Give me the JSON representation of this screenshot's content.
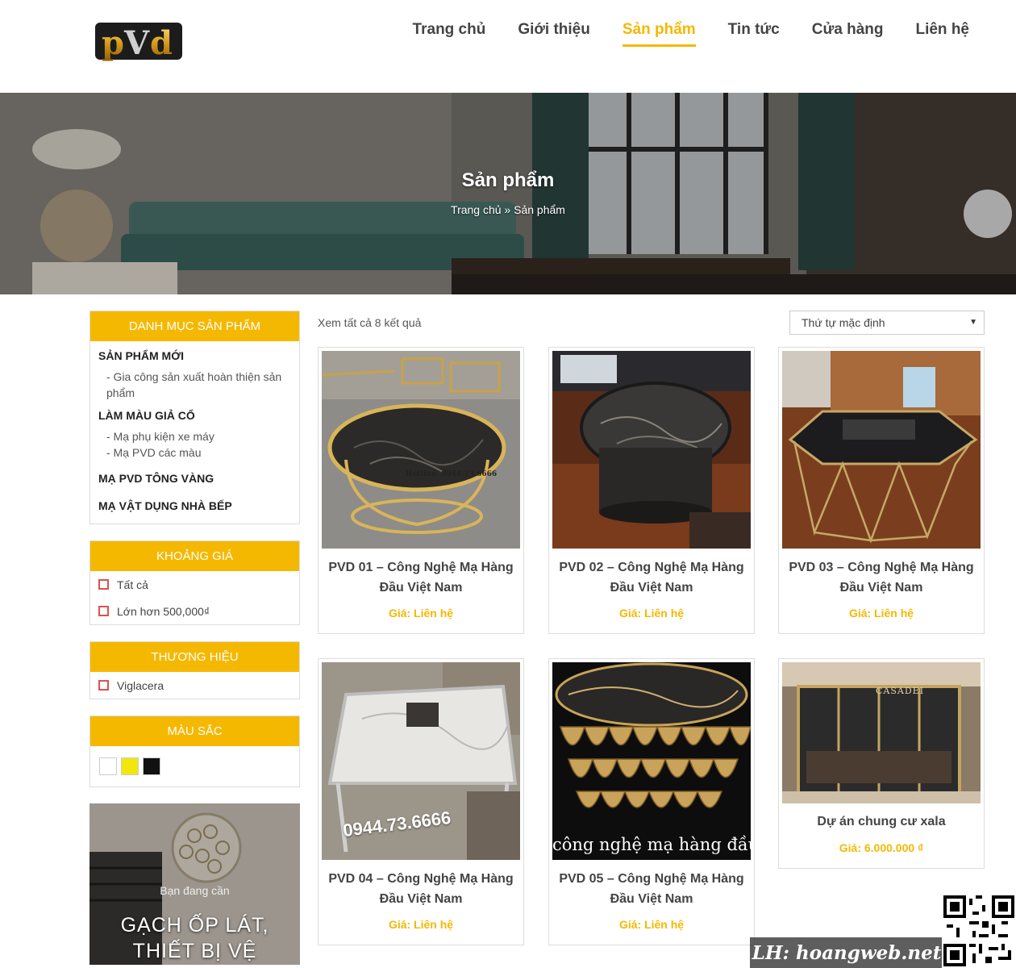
{
  "header": {
    "logo_text": "PVd",
    "nav": [
      {
        "label": "Trang chủ",
        "active": false
      },
      {
        "label": "Giới thiệu",
        "active": false
      },
      {
        "label": "Sản phẩm",
        "active": true
      },
      {
        "label": "Tin tức",
        "active": false
      },
      {
        "label": "Cửa hàng",
        "active": false
      },
      {
        "label": "Liên hệ",
        "active": false
      }
    ]
  },
  "banner": {
    "title": "Sản phẩm",
    "breadcrumb_home": "Trang chủ",
    "breadcrumb_sep": " » ",
    "breadcrumb_current": "Sản phẩm"
  },
  "sidebar": {
    "categories_title": "DANH MỤC SẢN PHẨM",
    "categories": [
      {
        "name": "SẢN PHẨM MỚI",
        "children": [
          "- Gia công sản xuất hoàn thiện sản phẩm"
        ]
      },
      {
        "name": "LÀM MÀU GIẢ CỔ",
        "children": [
          "- Mạ phụ kiện xe máy",
          "- Mạ PVD các màu"
        ]
      },
      {
        "name": "MẠ PVD TÔNG VÀNG",
        "children": []
      },
      {
        "name": "MẠ VẬT DỤNG NHÀ BẾP",
        "children": []
      }
    ],
    "price_title": "KHOẢNG GIÁ",
    "price_options": [
      "Tất cả",
      "Lớn hơn 500,000₫"
    ],
    "brand_title": "THƯƠNG HIỆU",
    "brand_options": [
      "Viglacera"
    ],
    "color_title": "MÀU SẮC",
    "colors": [
      "#ffffff",
      "#f2e60c",
      "#111111"
    ],
    "promo_small": "Bạn đang cần",
    "promo_big": "GẠCH ỐP LÁT, THIẾT BỊ VỆ"
  },
  "content": {
    "result_count": "Xem tất cả 8 kết quả",
    "sort_selected": "Thứ tự mặc định",
    "products": [
      {
        "name": "PVD 01 – Công Nghệ Mạ Hàng Đầu Việt Nam",
        "price": "Giá: Liên hệ",
        "img_caption": "Hotline: 0944.73.6666"
      },
      {
        "name": "PVD 02 – Công Nghệ Mạ Hàng Đầu Việt Nam",
        "price": "Giá: Liên hệ",
        "img_caption": ""
      },
      {
        "name": "PVD 03 – Công Nghệ Mạ Hàng Đầu Việt Nam",
        "price": "Giá: Liên hệ",
        "img_caption": ""
      },
      {
        "name": "PVD 04 – Công Nghệ Mạ Hàng Đầu Việt Nam",
        "price": "Giá: Liên hệ",
        "img_caption": "0944.73.6666"
      },
      {
        "name": "PVD 05 – Công Nghệ Mạ Hàng Đầu Việt Nam",
        "price": "Giá: Liên hệ",
        "img_caption": "công nghệ mạ hàng đầu V"
      },
      {
        "name": "Dự án chung cư xala",
        "price": "Giá: 6.000.000 ₫",
        "img_caption": "CASADEI"
      }
    ]
  },
  "watermark": "LH: hoangweb.net",
  "colors": {
    "accent": "#f5b800",
    "text": "#444444",
    "border": "#dddddd"
  }
}
